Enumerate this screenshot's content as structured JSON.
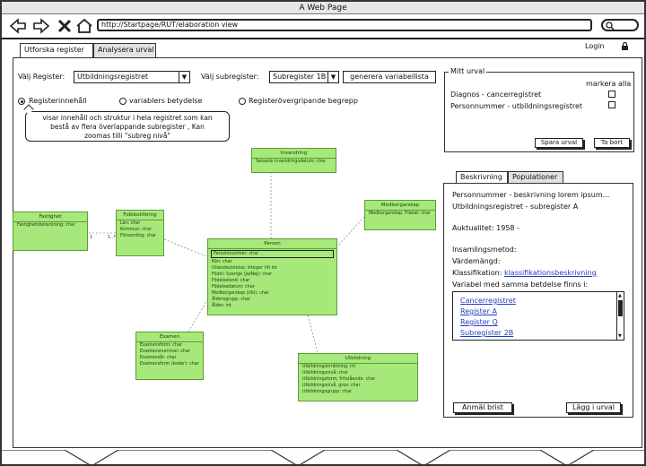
{
  "window": {
    "title": "A Web Page"
  },
  "browser": {
    "url": "http://Startpage/RUT/elaboration view"
  },
  "tabs": [
    {
      "label": "Utforska register",
      "active": true
    },
    {
      "label": "Analysera urval",
      "active": false
    }
  ],
  "login": {
    "label": "Login"
  },
  "filters": {
    "register_label": "Välj Register:",
    "register_value": "Utbildningsregistret",
    "subregister_label": "Välj subregister:",
    "subregister_value": "Subregister 1B",
    "generate_button": "generera variabellista"
  },
  "radios": [
    {
      "label": "Registerinnehåll",
      "selected": true
    },
    {
      "label": "variablers betydelse",
      "selected": false
    },
    {
      "label": "Registeröver­gripande begrepp",
      "selected": false
    }
  ],
  "tooltip": {
    "line1": "visar innehåll och struktur i hela registret som kan",
    "line2": "bestå av flera överlappande subregister , Kan",
    "line3": "zoomas tilli  \"subreg nivå\""
  },
  "selection": {
    "legend": "Mitt urval",
    "mark_all": "markera alla",
    "items": [
      "Diagnos - cancerregistret",
      "Personnummer - utbildningsregistret"
    ],
    "save_button": "Spara urval",
    "remove_button": "Ta bort"
  },
  "detail_tabs": [
    {
      "label": "Beskrivning",
      "active": true
    },
    {
      "label": "Populationer",
      "active": false
    }
  ],
  "detail": {
    "line1": "Personnummer - beskrivning lorem ipsum...",
    "line2": "Utbildningsregistret - subregister A",
    "actuality": "Auktualitet: 1958 -",
    "method": "Insamlingsmetod:",
    "valueset": "Värdemängd:",
    "classification_label": "Klassifikation:",
    "classification_link": "klassifikationsbeskrivning",
    "same_meaning": "Variabel med samma betdelse finns i:",
    "list": [
      "Cancerregistret",
      "Register A",
      "Register Q",
      "Subregister 2B"
    ],
    "report_button": "Anmäl brist",
    "add_button": "Lägg i urval"
  },
  "uml": {
    "invandring": {
      "title": "Invandring",
      "rows": [
        "Senaste invandringsdatum: char"
      ]
    },
    "medborgarskap": {
      "title": "Medborgarskap",
      "rows": [
        "Medborgarskap, Fdelat: char"
      ]
    },
    "fastighet": {
      "title": "Fastighet",
      "rows": [
        "Fastighetsbeteckning: char"
      ]
    },
    "folkbokforing": {
      "title": "Folkbokföring",
      "rows": [
        "Län: char",
        "Kommun: char",
        "Församling: char"
      ]
    },
    "person": {
      "title": "Person",
      "rows": [
        "Personnummer: char",
        "Kön: char",
        "Utlandsvistelse: integer (4) int",
        "Född i Sverige (Ja/Nej): char",
        "Födelseland: char",
        "Födelsedatum: char",
        "Medborgarskap (Vbl): char",
        "Åldersgrupp: char",
        "Ålder: int"
      ]
    },
    "examen": {
      "title": "Examen",
      "rows": [
        "Examensform: char",
        "Examensnummer: char",
        "Examensår: char",
        "Examensform (koder): char"
      ]
    },
    "utbildning": {
      "title": "Utbildning",
      "rows": [
        "Utbildningsinriktning: int",
        "Utbildningsnivå: char",
        "Utbildningsform, fritstående: char",
        "Utbildningsnivå, grov: char",
        "Utbildningsgrupp: char"
      ]
    }
  }
}
